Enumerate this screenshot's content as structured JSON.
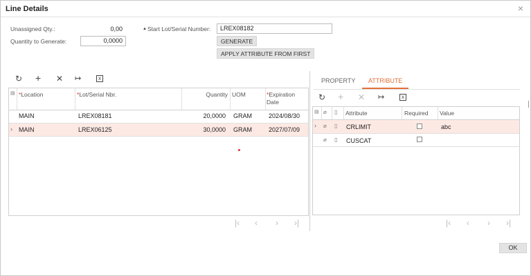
{
  "dialog": {
    "title": "Line Details",
    "close_icon": "×"
  },
  "header": {
    "unassigned_qty_label": "Unassigned Qty.:",
    "unassigned_qty_value": "0,00",
    "qty_to_generate_label": "Quantity to Generate:",
    "qty_to_generate_value": "0,0000",
    "start_lot_label": "Start Lot/Serial Number:",
    "start_lot_value": "LREX08182",
    "generate_button": "GENERATE",
    "apply_attribute_button": "APPLY ATTRIBUTE FROM FIRST"
  },
  "left_grid": {
    "columns": {
      "location": "Location",
      "lot_serial": "Lot/Serial Nbr.",
      "quantity": "Quantity",
      "uom": "UOM",
      "expiration": "Expiration Date"
    },
    "rows": [
      {
        "location": "MAIN",
        "lot": "LREX08181",
        "quantity": "20,0000",
        "uom": "GRAM",
        "expiration": "2024/08/30",
        "selected": false
      },
      {
        "location": "MAIN",
        "lot": "LREX06125",
        "quantity": "30,0000",
        "uom": "GRAM",
        "expiration": "2027/07/09",
        "selected": true
      }
    ]
  },
  "tabs": {
    "property": "PROPERTY",
    "attribute": "ATTRIBUTE",
    "active": "attribute"
  },
  "right_grid": {
    "columns": {
      "attribute": "Attribute",
      "required": "Required",
      "value": "Value"
    },
    "rows": [
      {
        "attribute": "CRLIMIT",
        "required": false,
        "value": "abc",
        "selected": true
      },
      {
        "attribute": "CUSCAT",
        "required": false,
        "value": "",
        "selected": false
      }
    ]
  },
  "footer": {
    "ok_button": "OK"
  },
  "colors": {
    "accent": "#e0703a",
    "selected_row": "#fde9e4",
    "required_star": "#e03030"
  }
}
